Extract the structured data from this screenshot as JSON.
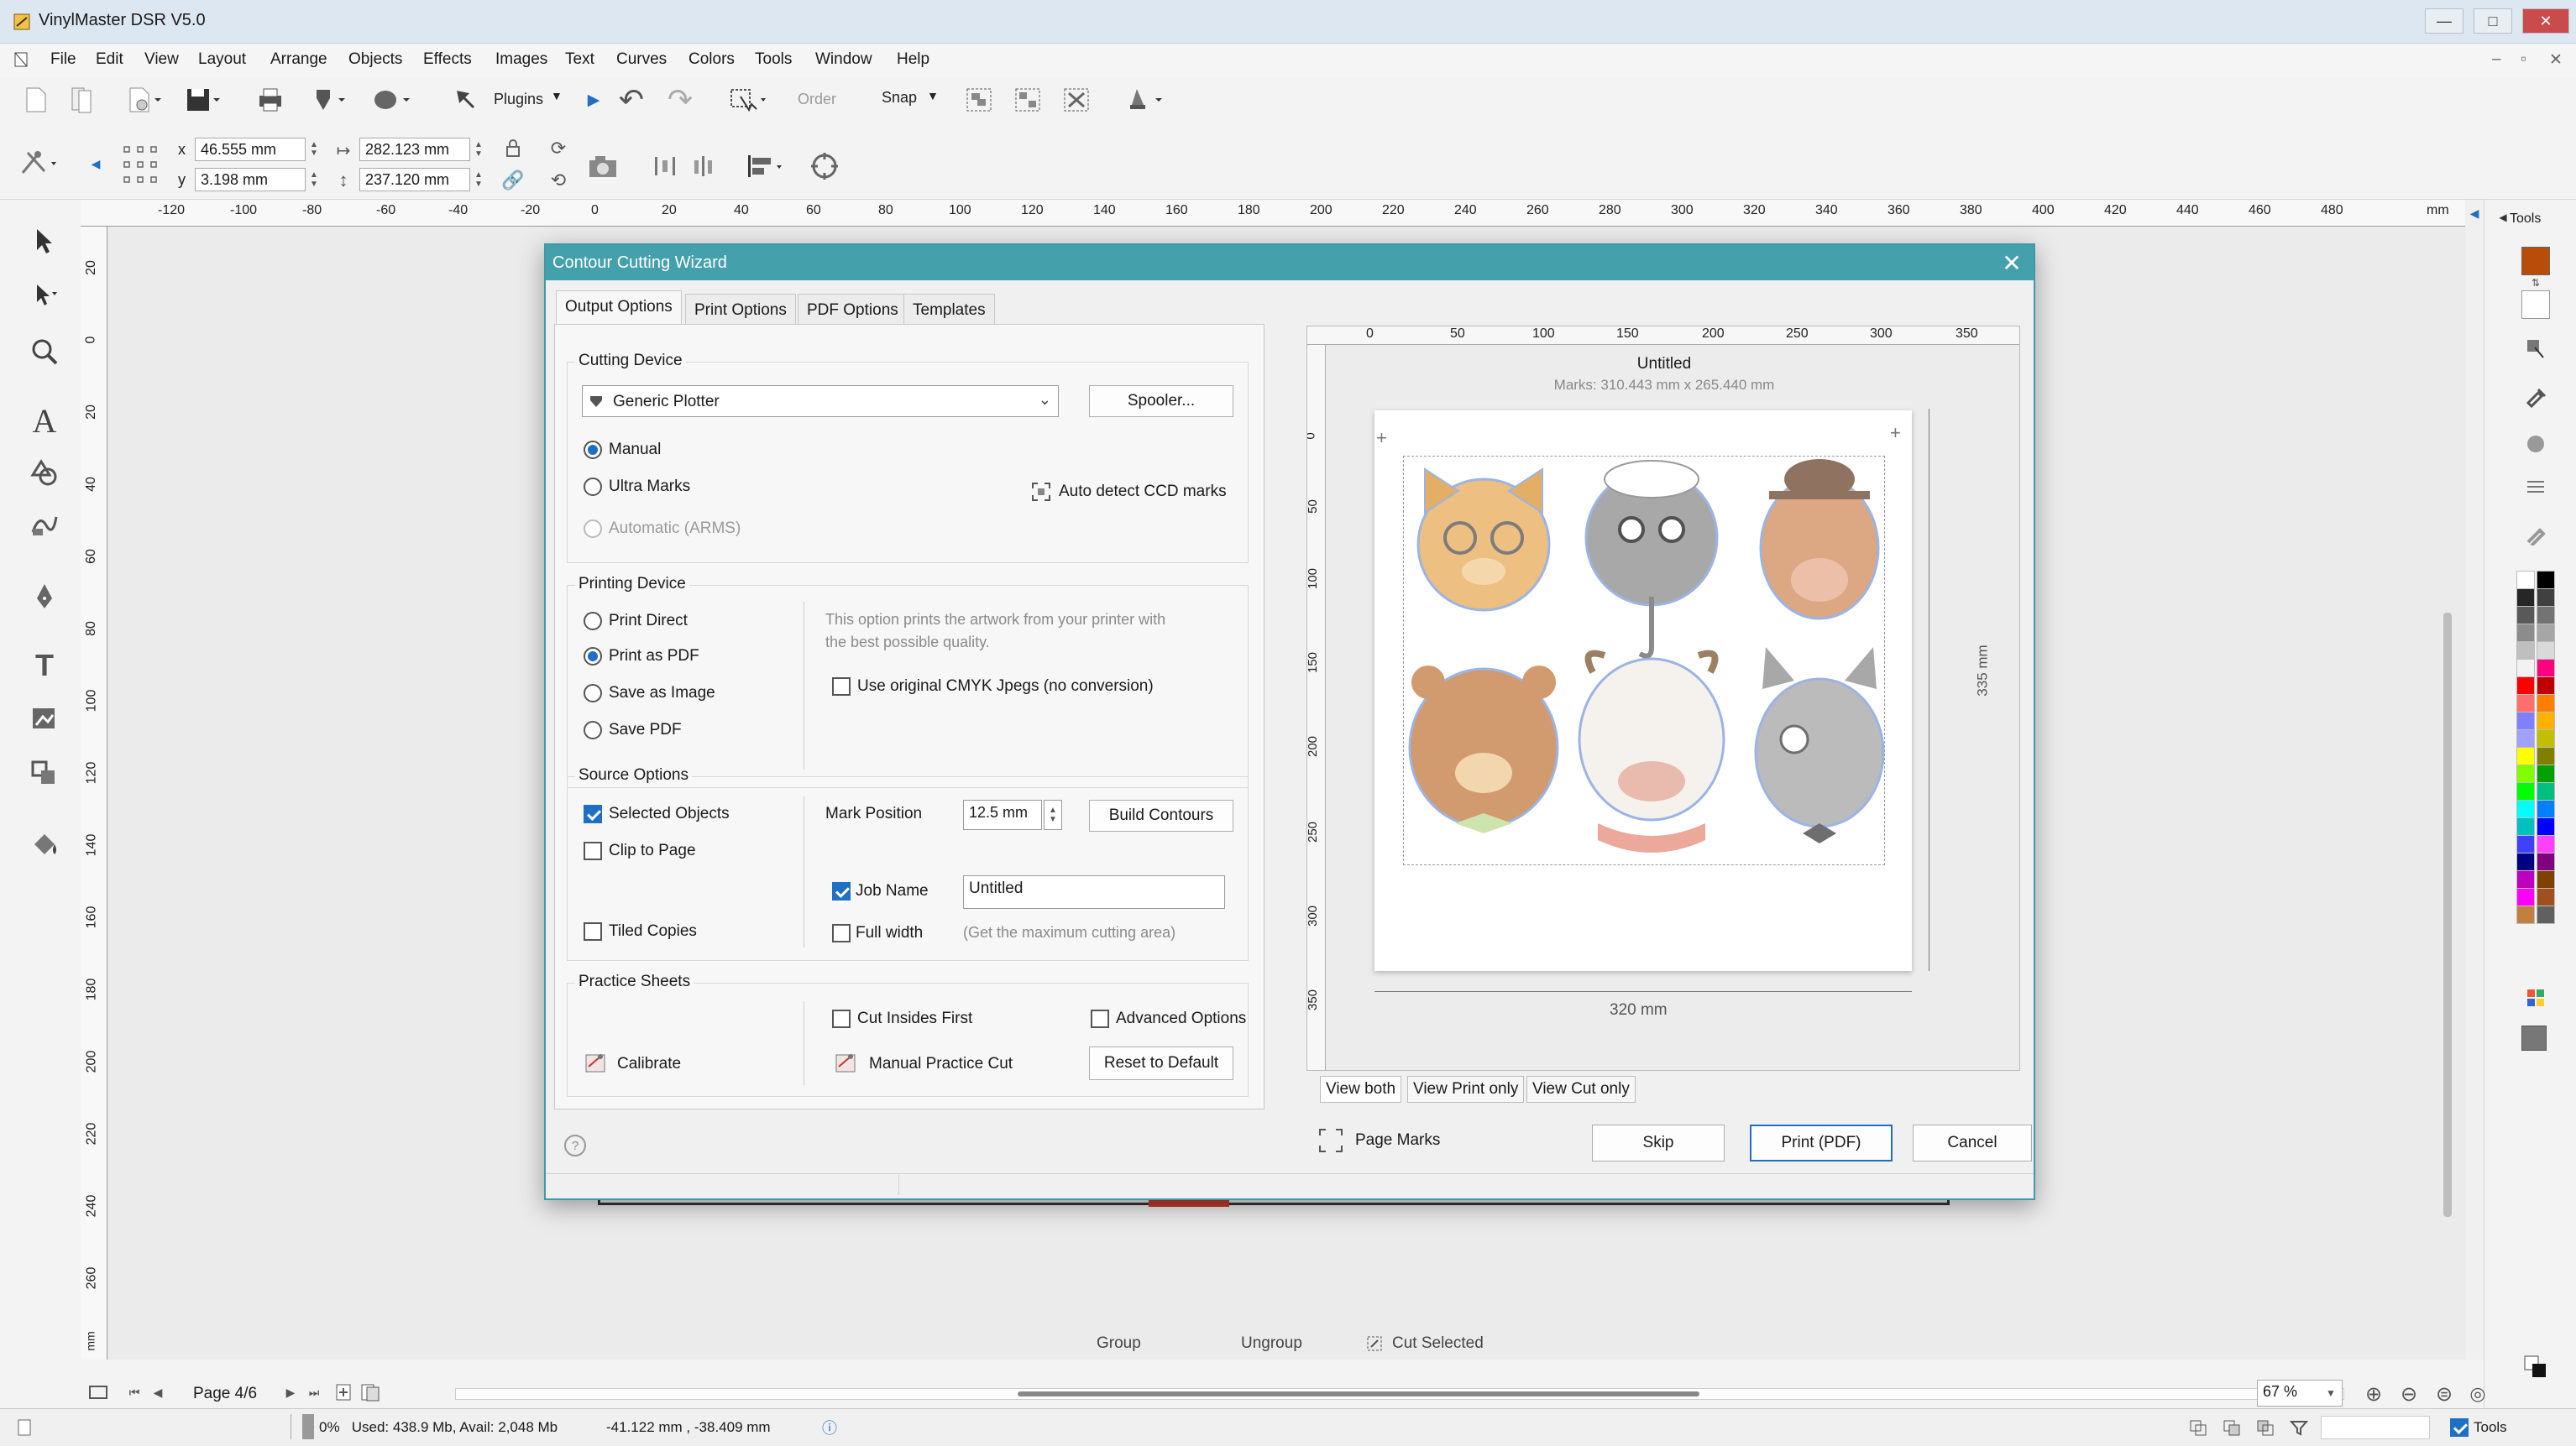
{
  "app": {
    "title": "VinylMaster DSR V5.0"
  },
  "menu": [
    "File",
    "Edit",
    "View",
    "Layout",
    "Arrange",
    "Objects",
    "Effects",
    "Images",
    "Text",
    "Curves",
    "Colors",
    "Tools",
    "Window",
    "Help"
  ],
  "toolbar": {
    "plugins": "Plugins",
    "order": "Order",
    "snap": "Snap"
  },
  "props": {
    "x_label": "x",
    "y_label": "y",
    "x": "46.555 mm",
    "y": "3.198 mm",
    "w": "282.123 mm",
    "h": "237.120 mm"
  },
  "ruler": {
    "h_ticks": [
      "-120",
      "-100",
      "-80",
      "-60",
      "-40",
      "-20",
      "0",
      "20",
      "40",
      "60",
      "80",
      "100",
      "120",
      "140",
      "160",
      "180",
      "200",
      "220",
      "240",
      "260",
      "280",
      "300",
      "320",
      "340",
      "360",
      "380",
      "400",
      "420",
      "440",
      "460",
      "480"
    ],
    "unit": "mm",
    "v_ticks": [
      "20",
      "0",
      "20",
      "40",
      "60",
      "80",
      "100",
      "120",
      "140",
      "160",
      "180",
      "200",
      "220",
      "240",
      "260"
    ]
  },
  "dialog": {
    "title": "Contour Cutting Wizard",
    "tabs": [
      "Output Options",
      "Print Options",
      "PDF Options",
      "Templates"
    ],
    "cutting_device": {
      "label": "Cutting Device",
      "device": "Generic Plotter",
      "spooler": "Spooler...",
      "modes": [
        "Manual",
        "Ultra Marks",
        "Automatic (ARMS)"
      ],
      "selected_mode": "Manual",
      "auto_detect": "Auto detect CCD marks"
    },
    "printing_device": {
      "label": "Printing Device",
      "options": [
        "Print Direct",
        "Print as PDF",
        "Save as Image",
        "Save PDF"
      ],
      "selected": "Print as PDF",
      "description": "This option prints the artwork from your printer with the best possible quality.",
      "use_cmyk": "Use original CMYK Jpegs (no conversion)"
    },
    "source_options": {
      "label": "Source Options",
      "selected_objects": "Selected Objects",
      "clip_to_page": "Clip to Page",
      "tiled_copies": "Tiled Copies",
      "mark_position_label": "Mark Position",
      "mark_position": "12.5 mm",
      "build_contours": "Build Contours",
      "job_name_label": "Job Name",
      "job_name": "Untitled",
      "full_width": "Full width",
      "full_width_hint": "(Get the maximum cutting area)"
    },
    "practice": {
      "label": "Practice Sheets",
      "cut_insides_first": "Cut Insides First",
      "advanced_options": "Advanced Options",
      "calibrate": "Calibrate",
      "manual_practice_cut": "Manual Practice Cut",
      "reset_default": "Reset to Default"
    },
    "preview": {
      "title": "Untitled",
      "marks": "Marks: 310.443 mm x 265.440 mm",
      "width": "320 mm",
      "height": "335 mm",
      "ruler_h": [
        "0",
        "50",
        "100",
        "150",
        "200",
        "250",
        "300",
        "350"
      ],
      "ruler_v": [
        "0",
        "50",
        "100",
        "150",
        "200",
        "250",
        "300",
        "350"
      ]
    },
    "view_tabs": [
      "View both",
      "View Print only",
      "View Cut only"
    ],
    "page_marks": "Page Marks",
    "buttons": {
      "skip": "Skip",
      "print": "Print (PDF)",
      "cancel": "Cancel"
    },
    "help": "?"
  },
  "bottom": {
    "page": "Page 4/6",
    "group": "Group",
    "ungroup": "Ungroup",
    "cut_selected": "Cut Selected",
    "zoom": "67 %"
  },
  "status": {
    "memory": "0%   Used: 438.9 Mb, Avail: 2,048 Mb",
    "coords": "-41.122 mm , -38.409 mm",
    "tools": "Tools"
  },
  "right_panel": {
    "tools_label": "Tools"
  },
  "palette": [
    "#ffffff",
    "#000000",
    "#262626",
    "#404040",
    "#595959",
    "#737373",
    "#8c8c8c",
    "#a6a6a6",
    "#bfbfbf",
    "#d9d9d9",
    "#f2f2f2",
    "#ff0080",
    "#ff0000",
    "#c00000",
    "#ff6f6f",
    "#ff8000",
    "#8080ff",
    "#ffb000",
    "#a0a0ff",
    "#c0c000",
    "#ffff00",
    "#808000",
    "#80ff00",
    "#00a000",
    "#00ff00",
    "#00c080",
    "#00ffff",
    "#0080ff",
    "#00c0c0",
    "#0000ff",
    "#4040ff",
    "#ff40ff",
    "#000080",
    "#800080",
    "#c000c0",
    "#804000",
    "#ff00ff",
    "#a05020",
    "#c08040",
    "#606060"
  ]
}
